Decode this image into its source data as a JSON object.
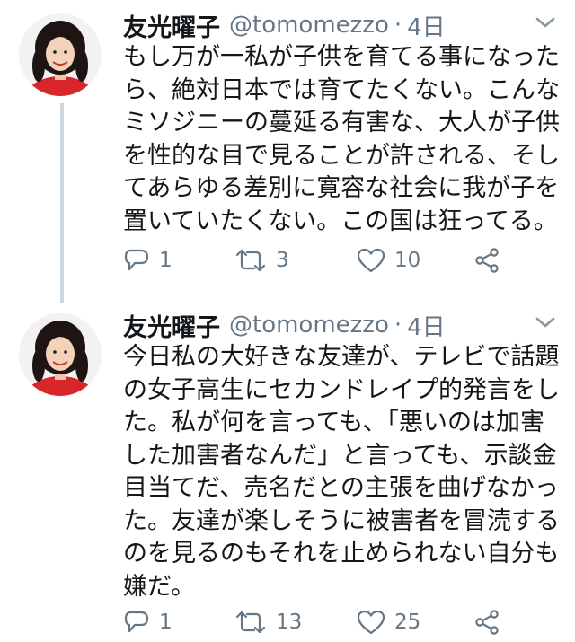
{
  "tweets": [
    {
      "name": "友光曜子",
      "handle": "@tomomezzo",
      "separator": "·",
      "time": "4日",
      "text_lines": [
        "もし万が一私が子供を育てる事になった",
        "ら、絶対日本では育てたくない。こんな",
        "ミソジニーの蔓延る有害な、大人が子供",
        "を性的な目で見ることが許される、そし",
        "てあらゆる差別に寛容な社会に我が子を",
        "置いていたくない。この国は狂ってる。"
      ],
      "replies": "1",
      "retweets": "3",
      "likes": "10"
    },
    {
      "name": "友光曜子",
      "handle": "@tomomezzo",
      "separator": "·",
      "time": "4日",
      "text_lines": [
        "今日私の大好きな友達が、テレビで話題",
        "の女子高生にセカンドレイプ的発言をし",
        "た。私が何を言っても、「悪いのは加害",
        "した加害者なんだ」と言っても、示談金",
        "目当てだ、売名だとの主張を曲げなかっ",
        "た。友達が楽しそうに被害者を冒涜する",
        "のを見るのもそれを止められない自分も",
        "嫌だ。"
      ],
      "replies": "1",
      "retweets": "13",
      "likes": "25"
    }
  ],
  "colors": {
    "text": "#14171a",
    "secondary": "#657786",
    "thread_line": "#ccd6dd"
  },
  "icons": [
    "reply-icon",
    "retweet-icon",
    "like-icon",
    "share-icon",
    "chevron-down-icon"
  ]
}
